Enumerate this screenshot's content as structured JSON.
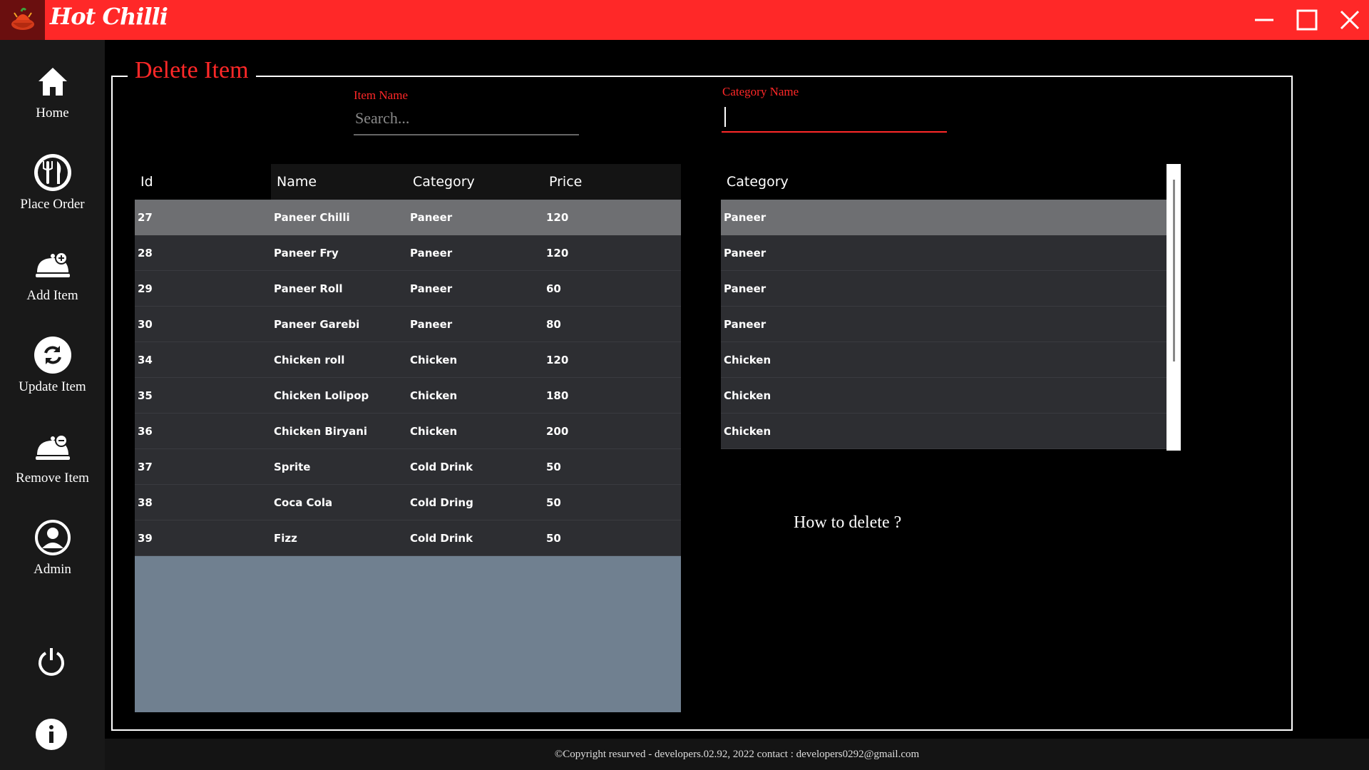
{
  "window": {
    "title": "Hot Chilli",
    "accent_color": "#ff2828",
    "controls": [
      "minimize-icon",
      "maximize-icon",
      "close-icon"
    ]
  },
  "sidebar": {
    "items": [
      {
        "label": "Home",
        "icon": "home-icon"
      },
      {
        "label": "Place Order",
        "icon": "fork-knife-icon"
      },
      {
        "label": "Add Item",
        "icon": "cloche-add-icon"
      },
      {
        "label": "Update Item",
        "icon": "refresh-icon"
      },
      {
        "label": "Remove Item",
        "icon": "cloche-remove-icon"
      },
      {
        "label": "Admin",
        "icon": "user-icon"
      }
    ],
    "bottom": [
      "power-icon",
      "info-icon"
    ]
  },
  "page": {
    "title": "Delete Item",
    "item_name_label": "Item Name",
    "item_search_placeholder": "Search...",
    "category_name_label": "Category Name",
    "category_input_value": "",
    "how_to": "How to delete ?"
  },
  "items_table": {
    "columns": [
      "Id",
      "Name",
      "Category",
      "Price"
    ],
    "rows": [
      [
        "27",
        "Paneer Chilli",
        "Paneer",
        "120"
      ],
      [
        "28",
        "Paneer Fry",
        "Paneer",
        "120"
      ],
      [
        "29",
        "Paneer Roll",
        "Paneer",
        "60"
      ],
      [
        "30",
        "Paneer Garebi",
        "Paneer",
        "80"
      ],
      [
        "34",
        "Chicken roll",
        "Chicken",
        "120"
      ],
      [
        "35",
        "Chicken Lolipop",
        "Chicken",
        "180"
      ],
      [
        "36",
        "Chicken Biryani",
        "Chicken",
        "200"
      ],
      [
        "37",
        "Sprite",
        "Cold Drink",
        "50"
      ],
      [
        "38",
        "Coca Cola",
        "Cold Dring",
        "50"
      ],
      [
        "39",
        "Fizz",
        "Cold Drink",
        "50"
      ]
    ],
    "selected_row": 0
  },
  "category_table": {
    "columns": [
      "Category"
    ],
    "rows": [
      "Paneer",
      "Paneer",
      "Paneer",
      "Paneer",
      "Chicken",
      "Chicken",
      "Chicken"
    ],
    "selected_row": 0
  },
  "footer": {
    "text": "©Copyright resurved - developers.02.92, 2022  contact : developers0292@gmail.com"
  }
}
